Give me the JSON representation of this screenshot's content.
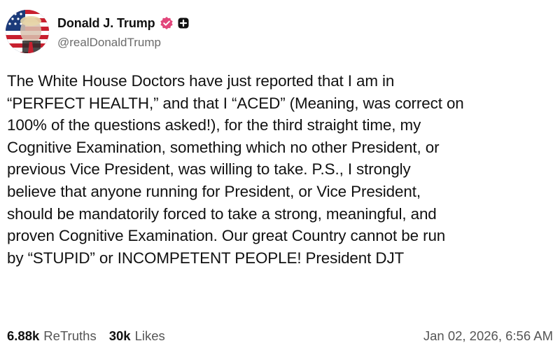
{
  "author": {
    "display_name": "Donald J. Trump",
    "handle": "@realDonaldTrump",
    "avatar_icon": "profile-photo-flag-icon",
    "verified_icon": "verified-badge-icon",
    "verified_color": "#e2467b",
    "plus_icon": "plus-badge-icon"
  },
  "post": {
    "lines": [
      "The White House Doctors have just reported that I am in",
      "“PERFECT HEALTH,” and that I “ACED” (Meaning, was correct on",
      "100% of the questions asked!), for the third straight time, my",
      "Cognitive Examination, something which no other President, or",
      "previous Vice President, was willing to take. P.S., I strongly",
      "believe that anyone running for President, or Vice President,",
      "should be mandatorily forced to take a strong, meaningful, and",
      "proven Cognitive Examination. Our great Country cannot be run",
      "by “STUPID” or INCOMPETENT PEOPLE! President DJT"
    ]
  },
  "stats": {
    "retruths_count": "6.88k",
    "retruths_label": "ReTruths",
    "likes_count": "30k",
    "likes_label": "Likes",
    "timestamp": "Jan 02, 2026, 6:56 AM"
  }
}
